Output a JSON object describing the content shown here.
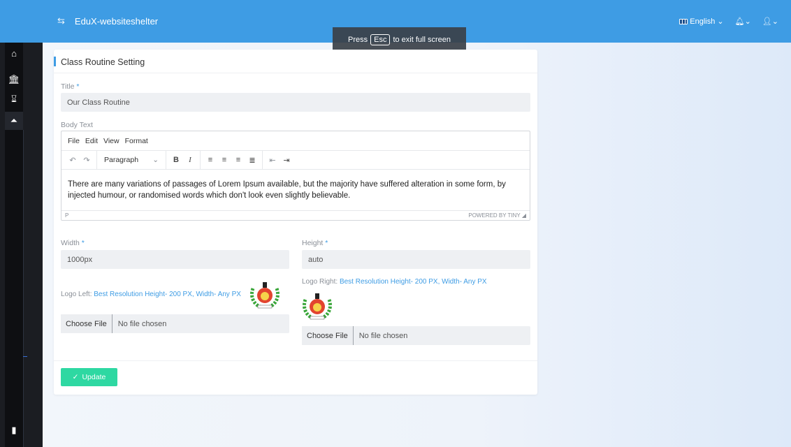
{
  "app": {
    "brand": "EduX-websiteshelter"
  },
  "topbar": {
    "language": "English"
  },
  "fullscreen": {
    "press": "Press",
    "key": "Esc",
    "rest": "to exit full screen"
  },
  "card": {
    "title": "Class Routine Setting"
  },
  "form": {
    "title_label": "Title",
    "title_value": "Our Class Routine",
    "body_label": "Body Text",
    "editor": {
      "menus": [
        "File",
        "Edit",
        "View",
        "Format"
      ],
      "block_format": "Paragraph",
      "content": "There are many variations of passages of Lorem Ipsum available, but the majority have suffered alteration in some form, by injected humour, or randomised words which don't look even slightly believable.",
      "status_path": "P",
      "powered_by": "POWERED BY TINY"
    },
    "width_label": "Width",
    "width_value": "1000px",
    "height_label": "Height",
    "height_value": "auto",
    "logo_left_label": "Logo Left:",
    "logo_left_hint": "Best Resolution Height- 200 PX, Width- Any PX",
    "logo_right_label": "Logo Right:",
    "logo_right_hint": "Best Resolution Height- 200 PX, Width- Any PX",
    "choose_file": "Choose File",
    "no_file": "No file chosen",
    "required_mark": "*",
    "update_button": "Update"
  },
  "colors": {
    "primary": "#3e9ce4",
    "success": "#2ed8a2",
    "sidebar": "#1b1d22"
  }
}
